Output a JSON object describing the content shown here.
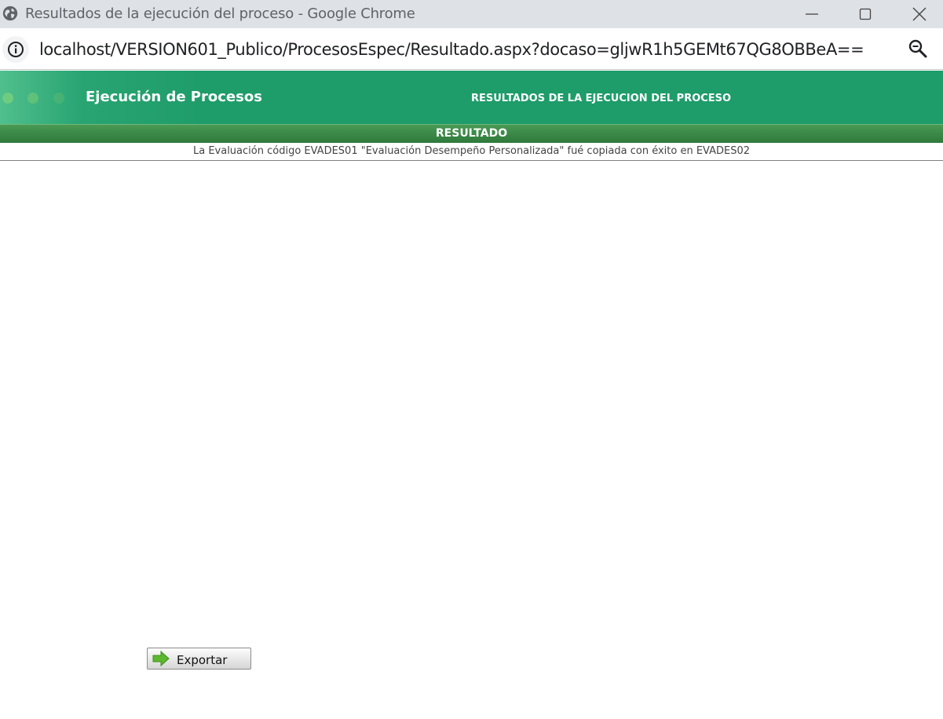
{
  "window": {
    "title": "Resultados de la ejecución del proceso - Google Chrome"
  },
  "address_bar": {
    "url": "localhost/VERSION601_Publico/ProcesosEspec/Resultado.aspx?docaso=gljwR1h5GEMt67QG8OBBeA=="
  },
  "header": {
    "app_title": "Ejecución de Procesos",
    "page_heading": "RESULTADOS DE LA EJECUCION DEL PROCESO"
  },
  "result": {
    "label": "RESULTADO",
    "message": "La Evaluación código EVADES01 \"Evaluación Desempeño Personalizada\" fué copiada con éxito en EVADES02"
  },
  "actions": {
    "export_label": "Exportar"
  },
  "colors": {
    "header_green": "#1e9c6a",
    "band_green": "#3c8a48",
    "export_arrow": "#5cb82e"
  }
}
